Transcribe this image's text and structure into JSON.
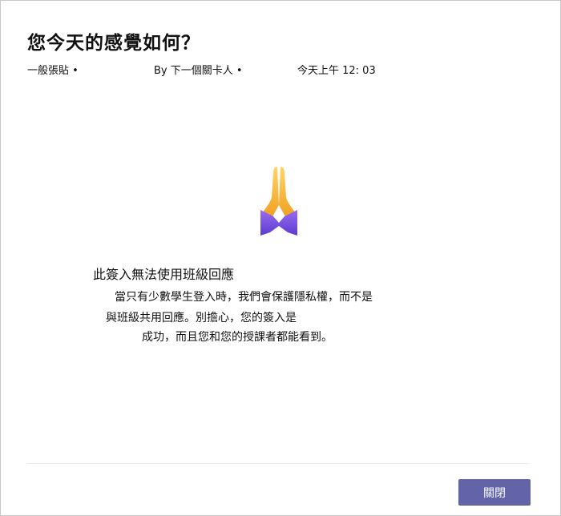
{
  "dialog": {
    "title": "您今天的感覺如何？",
    "channel_label": "一般張貼 •",
    "author_label": "By 下一個關卡人 •",
    "timestamp": "今天上午 12: 03"
  },
  "message": {
    "icon": "folded-hands-icon",
    "title": "此簽入無法使用班級回應",
    "line1": "當只有少數學生登入時，我們會保護隱私權，而不是",
    "line2": "與班級共用回應。別擔心，您的簽入是",
    "line3": "成功，而且您和您的授課者都能看到。"
  },
  "footer": {
    "close_label": "關閉"
  },
  "colors": {
    "accent": "#6264a7",
    "hands": "#f5a623",
    "sleeve": "#7b4fe0"
  }
}
